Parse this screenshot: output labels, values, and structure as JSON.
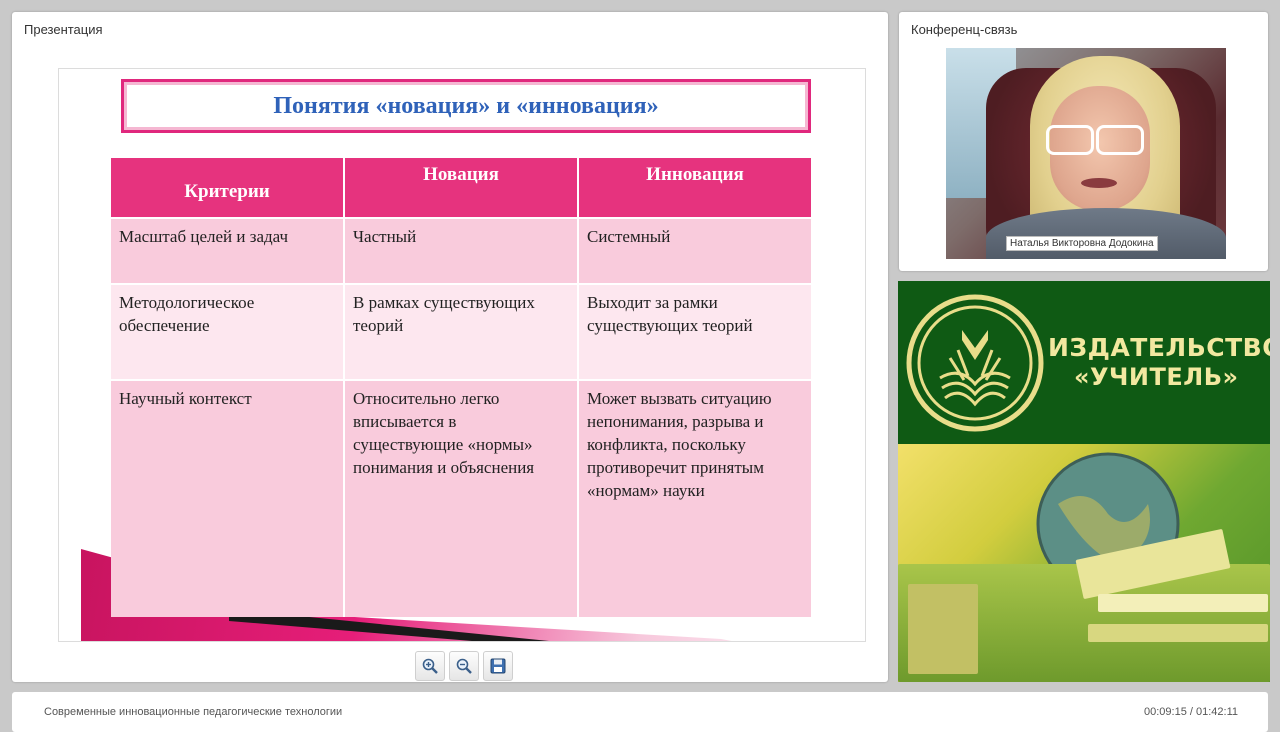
{
  "presentation": {
    "title": "Презентация",
    "slide": {
      "title": "Понятия «новация» и «инновация»",
      "table": {
        "headers": [
          "Критерии",
          "Новация",
          "Инновация"
        ],
        "rows": [
          [
            "Масштаб целей и задач",
            "Частный",
            "Системный"
          ],
          [
            "Методологическое обеспечение",
            "В рамках существующих теорий",
            "Выходит за рамки существующих теорий"
          ],
          [
            "Научный контекст",
            "Относительно легко вписывается в существующие «нормы» понимания и объяснения",
            "Может вызвать ситуацию непонимания, разрыва и конфликта, поскольку противоречит принятым «нормам» науки"
          ]
        ]
      },
      "accent_color": "#e6337e",
      "title_color": "#2f62b9"
    },
    "toolbar": {
      "zoom_in_icon": "zoom-in-icon",
      "zoom_out_icon": "zoom-out-icon",
      "save_icon": "floppy-disk-icon"
    }
  },
  "conference": {
    "title": "Конференц-связь",
    "participant_name": "Наталья Викторовна Додокина"
  },
  "ad": {
    "line1": "ИЗДАТЕЛЬСТВО",
    "line2": "«УЧИТЕЛЬ»",
    "brand_color": "#0f5a14"
  },
  "footer": {
    "course_title": "Современные инновационные педагогические технологии",
    "time": "00:09:15 / 01:42:11"
  }
}
